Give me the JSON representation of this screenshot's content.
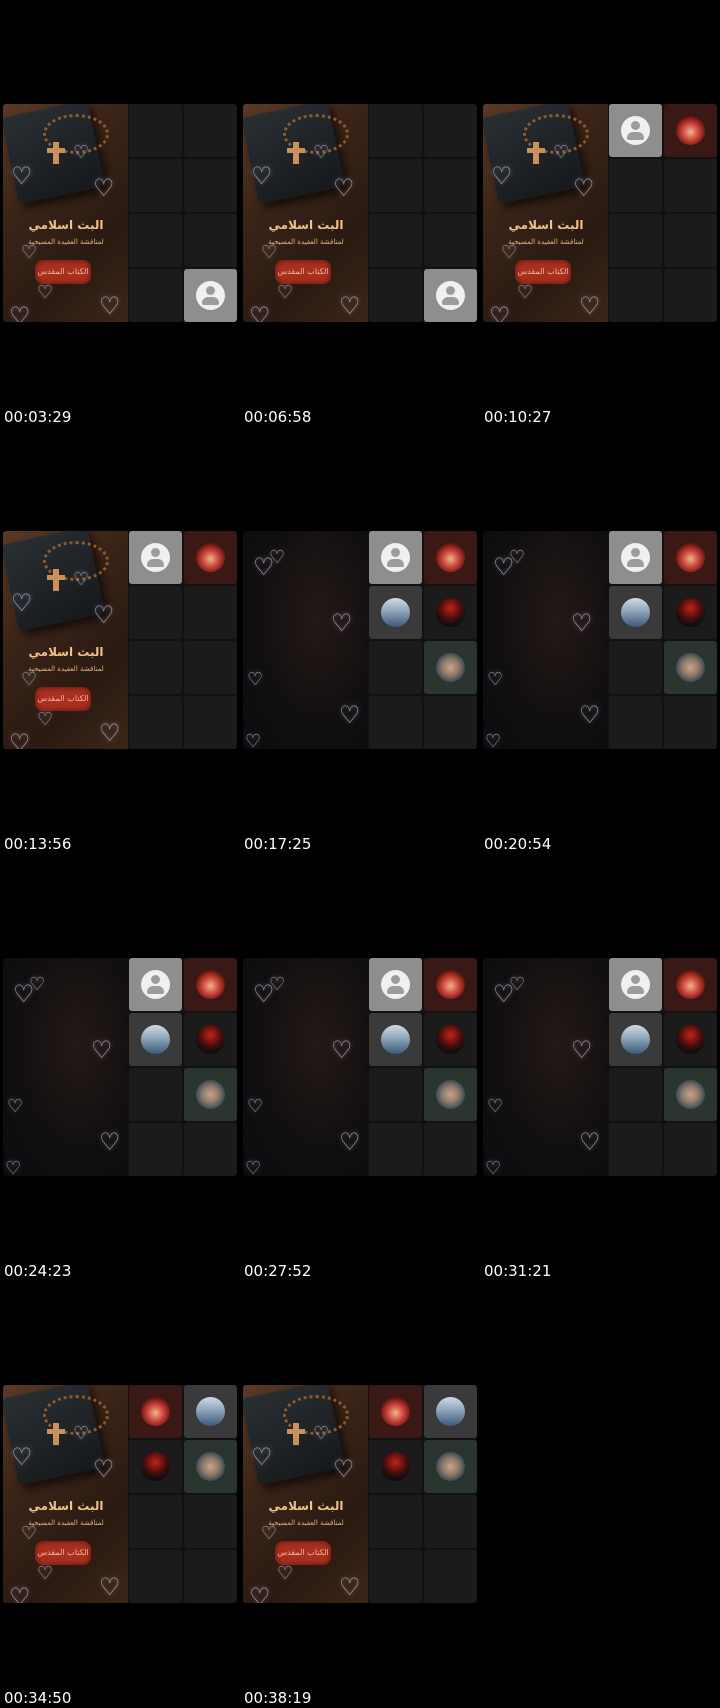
{
  "sheet": {
    "frames": [
      {
        "timestamp": "00:03:29",
        "art": "book",
        "cells": [
          "empty",
          "empty",
          "empty",
          "empty",
          "empty",
          "empty",
          "empty",
          "default"
        ]
      },
      {
        "timestamp": "00:06:58",
        "art": "book",
        "cells": [
          "empty",
          "empty",
          "empty",
          "empty",
          "empty",
          "empty",
          "empty",
          "default"
        ]
      },
      {
        "timestamp": "00:10:27",
        "art": "book",
        "cells": [
          "default",
          "redface",
          "empty",
          "empty",
          "empty",
          "empty",
          "empty",
          "empty"
        ]
      },
      {
        "timestamp": "00:13:56",
        "art": "book",
        "cells": [
          "default",
          "redface",
          "empty",
          "empty",
          "empty",
          "empty",
          "empty",
          "empty"
        ]
      },
      {
        "timestamp": "00:17:25",
        "art": "dark",
        "cells": [
          "default",
          "redface",
          "beach",
          "darkred",
          "empty",
          "manface",
          "empty",
          "empty"
        ]
      },
      {
        "timestamp": "00:20:54",
        "art": "dark",
        "cells": [
          "default",
          "redface",
          "beach",
          "darkred",
          "empty",
          "manface",
          "empty",
          "empty"
        ]
      },
      {
        "timestamp": "00:24:23",
        "art": "dark",
        "cells": [
          "default",
          "redface",
          "beach",
          "darkred",
          "empty",
          "manface",
          "empty",
          "empty"
        ]
      },
      {
        "timestamp": "00:27:52",
        "art": "dark",
        "cells": [
          "default",
          "redface",
          "beach",
          "darkred",
          "empty",
          "manface",
          "empty",
          "empty"
        ]
      },
      {
        "timestamp": "00:31:21",
        "art": "dark",
        "cells": [
          "default",
          "redface",
          "beach",
          "darkred",
          "empty",
          "manface",
          "empty",
          "empty"
        ]
      },
      {
        "timestamp": "00:34:50",
        "art": "book",
        "cells": [
          "redface",
          "beach",
          "darkred",
          "manface",
          "empty",
          "empty",
          "empty",
          "empty"
        ]
      },
      {
        "timestamp": "00:38:19",
        "art": "book",
        "cells": [
          "redface",
          "beach",
          "darkred",
          "manface",
          "empty",
          "empty",
          "empty",
          "empty"
        ]
      }
    ]
  },
  "poster": {
    "title": "البث اسلامي",
    "subtitle": "لمناقشة العقيدة المسيحية",
    "plaque": "الكتاب المقدس"
  }
}
